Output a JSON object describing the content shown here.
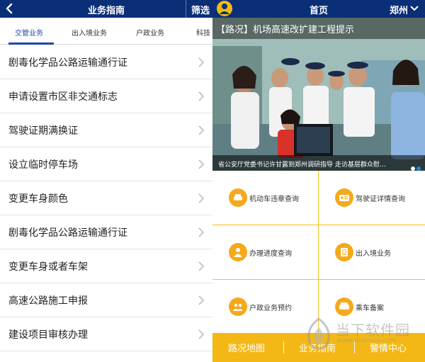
{
  "left_screen": {
    "header": {
      "title": "业务指南",
      "filter_label": "筛选"
    },
    "tabs": [
      {
        "label": "交管业务",
        "active": true
      },
      {
        "label": "出入境业务",
        "active": false
      },
      {
        "label": "户政业务",
        "active": false
      },
      {
        "label": "科技",
        "active": false
      }
    ],
    "items": [
      {
        "label": "剧毒化学品公路运输通行证"
      },
      {
        "label": "申请设置市区非交通标志"
      },
      {
        "label": "驾驶证期满换证"
      },
      {
        "label": "设立临时停车场"
      },
      {
        "label": "变更车身颜色"
      },
      {
        "label": "剧毒化学品公路运输通行证"
      },
      {
        "label": "变更车身或者车架"
      },
      {
        "label": "高速公路施工申报"
      },
      {
        "label": "建设项目审核办理"
      }
    ]
  },
  "right_screen": {
    "header": {
      "title": "首页",
      "city": "郑州"
    },
    "banner": {
      "headline": "【路况】机场高速改扩建工程提示",
      "caption": "省公安厅党委书记许甘露到郑州调研指导 走访基层群众慰…",
      "page_count": 2,
      "active_page": 2
    },
    "services": [
      {
        "label": "机动车违章查询",
        "icon": "car-icon"
      },
      {
        "label": "驾驶证详情查询",
        "icon": "license-card-icon"
      },
      {
        "label": "办理进度查询",
        "icon": "progress-person-icon"
      },
      {
        "label": "出入境业务",
        "icon": "passport-icon"
      },
      {
        "label": "户政业务预约",
        "icon": "household-icon"
      },
      {
        "label": "乘车备案",
        "icon": "vehicle-record-icon"
      }
    ],
    "bottom_nav": [
      {
        "label": "路况地图"
      },
      {
        "label": "业务指南"
      },
      {
        "label": "警情中心"
      }
    ]
  },
  "watermark": {
    "title": "当下软件园",
    "url": "www.downxia.com"
  },
  "colors": {
    "header_navy": "#0b2f77",
    "accent_yellow": "#f3b815",
    "tab_blue": "#1b48a8"
  }
}
